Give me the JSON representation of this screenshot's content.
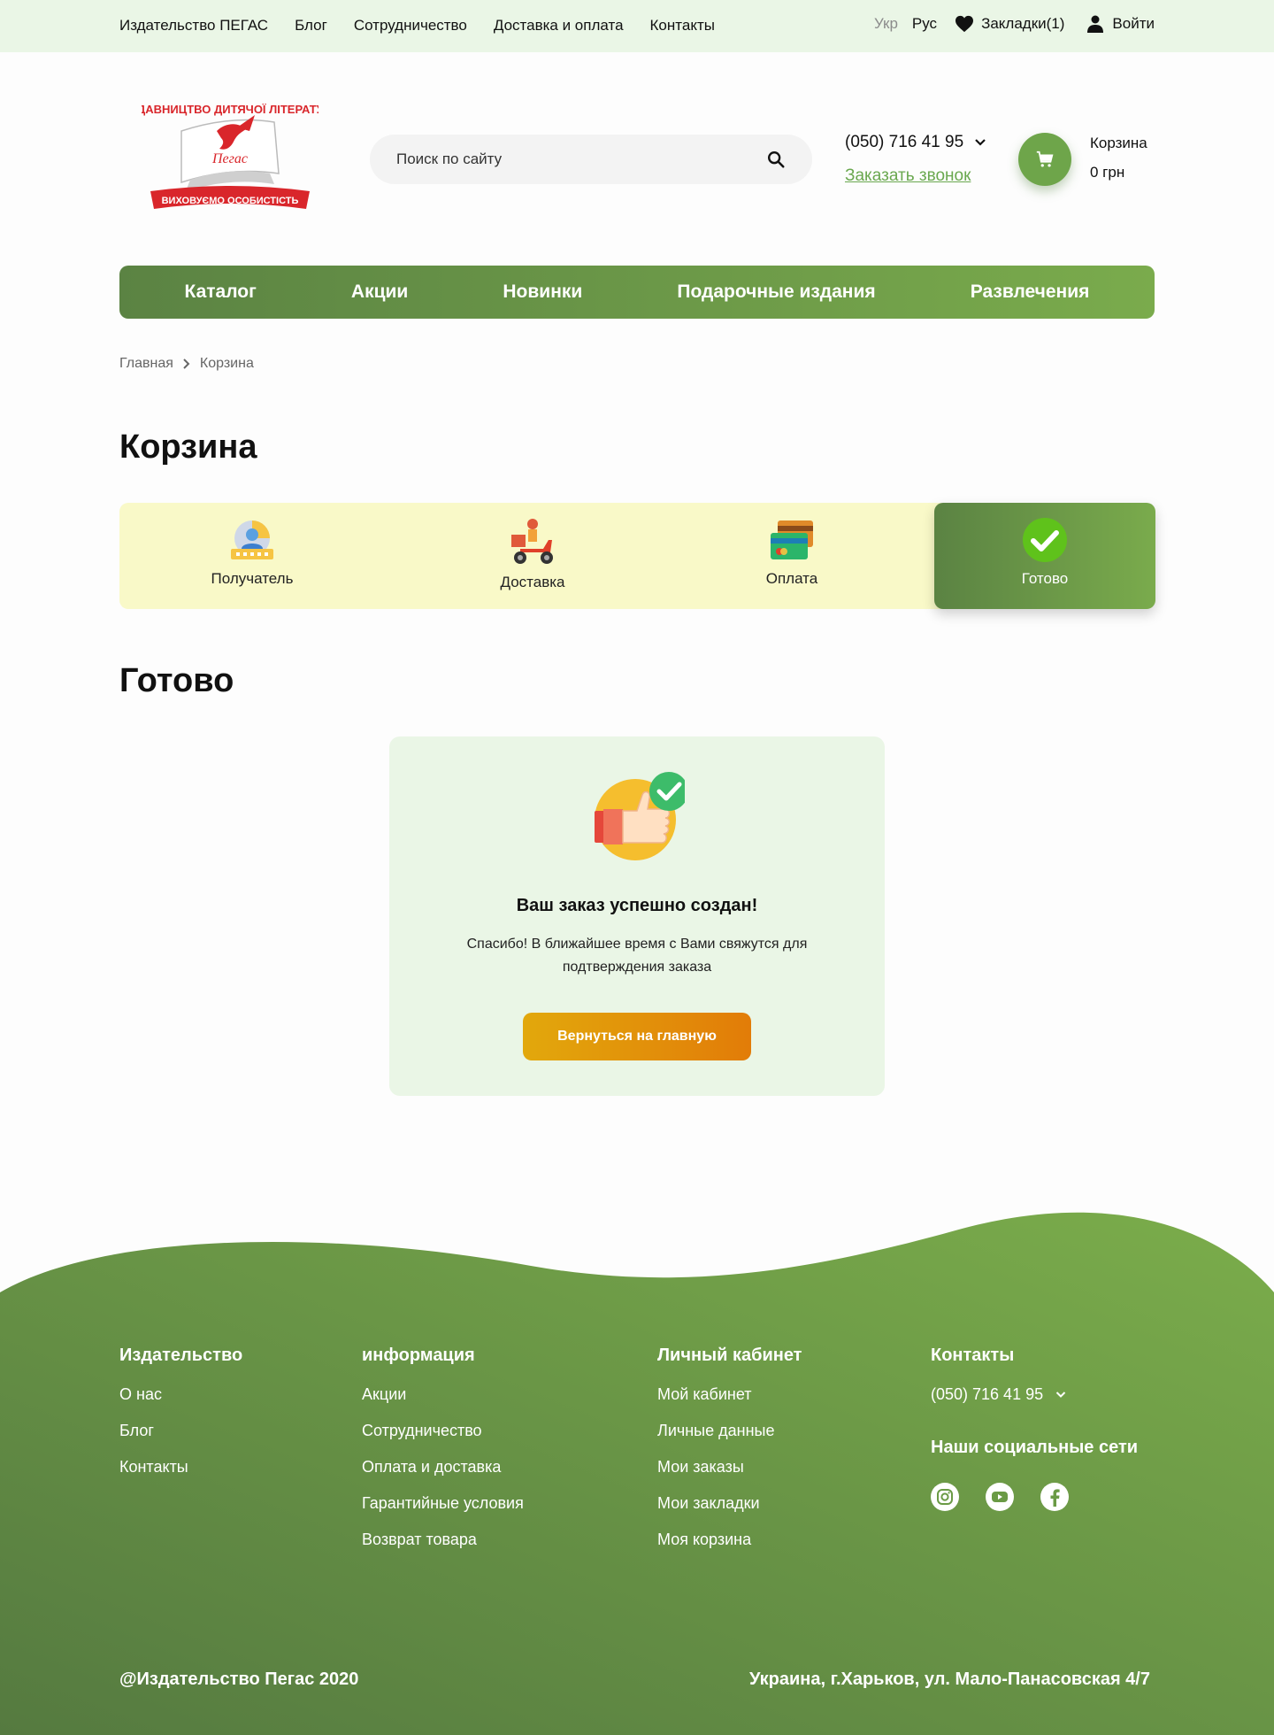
{
  "topbar": {
    "links": [
      "Издательство ПЕГАС",
      "Блог",
      "Сотрудничество",
      "Доставка и оплата",
      "Контакты"
    ],
    "lang_ukr": "Укр",
    "lang_rus": "Рус",
    "bookmarks": "Закладки(1)",
    "login": "Войти"
  },
  "header": {
    "logo_top_text": "ВИДАВНИЦТВО ДИТЯЧОЇ ЛІТЕРАТУРИ",
    "logo_name": "Пегас",
    "logo_ribbon": "ВИХОВУЄМО ОСОБИСТІСТЬ",
    "search_placeholder": "Поиск по сайту",
    "phone": "(050) 716 41 95",
    "callback": "Заказать звонок",
    "cart_label": "Корзина",
    "cart_total": "0 грн"
  },
  "nav": [
    "Каталог",
    "Акции",
    "Новинки",
    "Подарочные издания",
    "Развлечения"
  ],
  "breadcrumb": {
    "home": "Главная",
    "current": "Корзина"
  },
  "page_title": "Корзина",
  "steps": [
    {
      "label": "Получатель",
      "icon": "recipient-icon"
    },
    {
      "label": "Доставка",
      "icon": "delivery-scooter-icon"
    },
    {
      "label": "Оплата",
      "icon": "payment-card-icon"
    },
    {
      "label": "Готово",
      "icon": "check-icon",
      "active": true
    }
  ],
  "section_title": "Готово",
  "success": {
    "heading": "Ваш заказ успешно создан!",
    "message": "Спасибо! В ближайшее время с Вами свяжутся для подтверждения заказа",
    "button": "Вернуться на главную"
  },
  "footer": {
    "col1": {
      "title": "Издательство",
      "links": [
        "О нас",
        "Блог",
        "Контакты"
      ]
    },
    "col2": {
      "title": "информация",
      "links": [
        "Акции",
        "Сотрудничество",
        "Оплата и доставка",
        "Гарантийные условия",
        "Возврат товара"
      ]
    },
    "col3": {
      "title": "Личный кабинет",
      "links": [
        "Мой кабинет",
        "Личные данные",
        "Мои заказы",
        "Мои закладки",
        "Моя корзина"
      ]
    },
    "col4": {
      "title": "Контакты",
      "phone": "(050) 716 41 95",
      "social_title": "Наши социальные сети",
      "social": [
        "instagram-icon",
        "youtube-icon",
        "facebook-icon"
      ]
    },
    "copyright": "@Издательство Пегас 2020",
    "address": "Украина,  г.Харьков, ул. Мало-Панасовская 4/7"
  },
  "colors": {
    "green_dark": "#5b8343",
    "green_light": "#7aab4c",
    "accent_orange": "#e27c08",
    "topbar_bg": "#eaf6e6"
  }
}
